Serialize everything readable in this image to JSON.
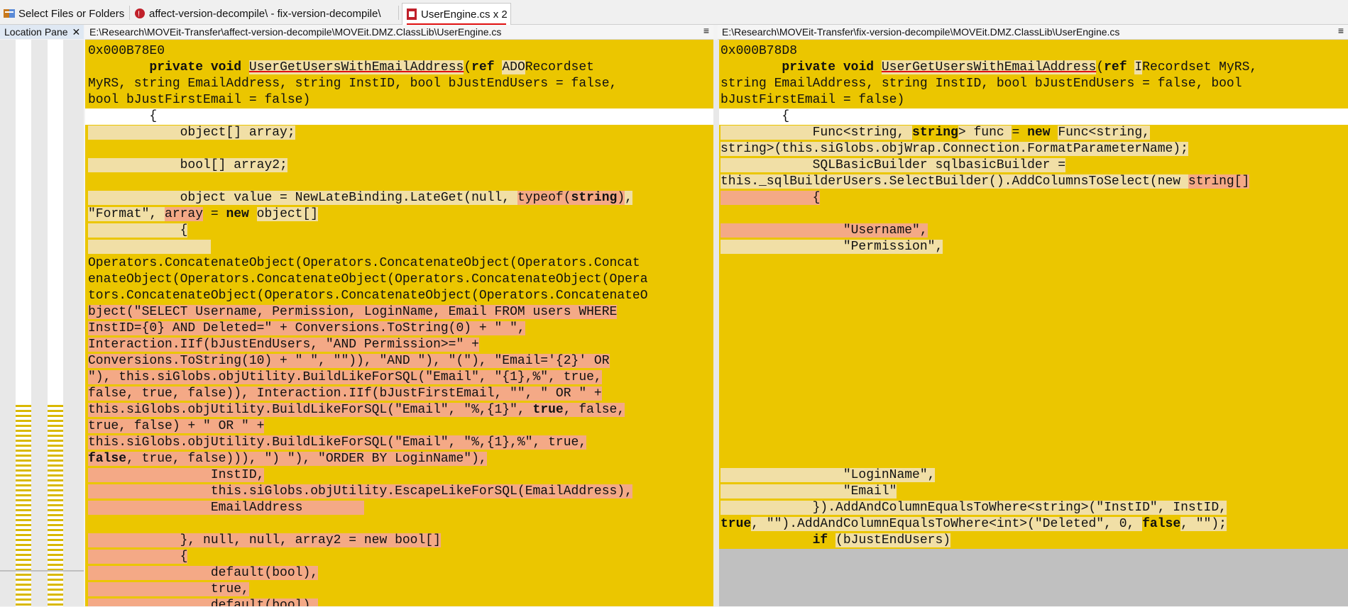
{
  "tabs": [
    {
      "label": "Select Files or Folders",
      "icon": "folder-compare-icon"
    },
    {
      "label": "affect-version-decompile\\ - fix-version-decompile\\",
      "icon": "folder-diff-icon"
    },
    {
      "label": "UserEngine.cs x 2",
      "icon": "file-diff-icon"
    }
  ],
  "location_pane": {
    "title": "Location Pane",
    "close": "✕"
  },
  "left_pane": {
    "path": "E:\\Research\\MOVEit-Transfer\\affect-version-decompile\\MOVEit.DMZ.ClassLib\\UserEngine.cs",
    "menu": "≡"
  },
  "right_pane": {
    "path": "E:\\Research\\MOVEit-Transfer\\fix-version-decompile\\MOVEit.DMZ.ClassLib\\UserEngine.cs",
    "menu": "≡"
  },
  "colors": {
    "diff_yellow": "#ebc600",
    "diff_light": "#f1dfa6",
    "diff_red": "#f4a986",
    "accent_red": "#e01010"
  },
  "left_lines": [
    "0x000B78E0",
    "        private void UserGetUsersWithEmailAddress(ref ADORecordset",
    "MyRS, string EmailAddress, string InstID, bool bJustEndUsers = false,",
    "bool bJustFirstEmail = false)",
    "        {",
    "            object[] array;",
    "",
    "            bool[] array2;",
    "",
    "            object value = NewLateBinding.LateGet(null, typeof(string),",
    "\"Format\", array = new object[]",
    "            {",
    "",
    "Operators.ConcatenateObject(Operators.ConcatenateObject(Operators.Concat",
    "enateObject(Operators.ConcatenateObject(Operators.ConcatenateObject(Opera",
    "tors.ConcatenateObject(Operators.ConcatenateObject(Operators.ConcatenateO",
    "bject(\"SELECT Username, Permission, LoginName, Email FROM users WHERE",
    "InstID={0} AND Deleted=\" + Conversions.ToString(0) + \" \",",
    "Interaction.IIf(bJustEndUsers, \"AND Permission>=\" +",
    "Conversions.ToString(10) + \" \", \"\")), \"AND \"), \"(\"), \"Email='{2}' OR",
    "\"), this.siGlobs.objUtility.BuildLikeForSQL(\"Email\", \"{1},%\", true,",
    "false, true, false)), Interaction.IIf(bJustFirstEmail, \"\", \" OR \" +",
    "this.siGlobs.objUtility.BuildLikeForSQL(\"Email\", \"%,{1}\", true, false,",
    "true, false) + \" OR \" +",
    "this.siGlobs.objUtility.BuildLikeForSQL(\"Email\", \"%,{1},%\", true,",
    "false, true, false))), \") \"), \"ORDER BY LoginName\"),",
    "                InstID,",
    "                this.siGlobs.objUtility.EscapeLikeForSQL(EmailAddress),",
    "                EmailAddress",
    "",
    "            }, null, null, array2 = new bool[]",
    "            {",
    "                default(bool),",
    "                true,",
    "                default(bool),"
  ],
  "right_lines": [
    "0x000B78D8",
    "        private void UserGetUsersWithEmailAddress(ref IRecordset MyRS,",
    "string EmailAddress, string InstID, bool bJustEndUsers = false, bool",
    "bJustFirstEmail = false)",
    "        {",
    "            Func<string, string> func = new Func<string,",
    "string>(this.siGlobs.objWrap.Connection.FormatParameterName);",
    "            SQLBasicBuilder sqlbasicBuilder =",
    "this._sqlBuilderUsers.SelectBuilder().AddColumnsToSelect(new string[]",
    "            {",
    "",
    "                \"Username\",",
    "                \"Permission\",",
    "                \"LoginName\",",
    "                \"Email\"",
    "            }).AddAndColumnEqualsToWhere<string>(\"InstID\", InstID,",
    "true, \"\").AddAndColumnEqualsToWhere<int>(\"Deleted\", 0, false, \"\");",
    "            if (bJustEndUsers)"
  ]
}
